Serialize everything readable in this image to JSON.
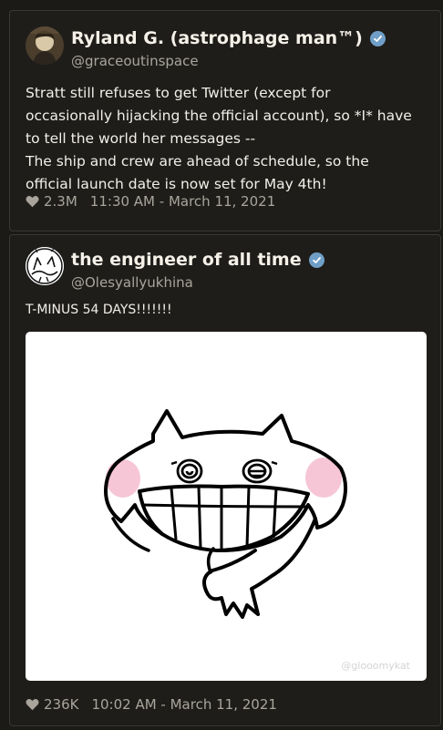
{
  "tweets": [
    {
      "display_name": "Ryland G. (astrophage man™)",
      "handle": "@graceoutinspace",
      "avatar_icon": "profile-photo",
      "verified_icon": "verified-check-icon",
      "text_lines": [
        "Stratt still refuses to get Twitter (except for",
        "occasionally hijacking the official account), so *I* have",
        "to tell the world her messages --",
        "The ship and crew are ahead of schedule, so the",
        "official launch date is now set for May 4th!"
      ],
      "likes": "2.3M",
      "timestamp": "11:30 AM - March 11, 2021"
    },
    {
      "display_name": "the engineer of all time",
      "handle": "@Olesyallyukhina",
      "avatar_icon": "cat-doodle-avatar",
      "verified_icon": "verified-check-icon",
      "text": "T-MINUS 54 DAYS!!!!!!!",
      "media_icon": "grinning-cat-doodle",
      "media_watermark": "@glooomykat",
      "likes": "236K",
      "timestamp": "10:02 AM - March 11, 2021"
    }
  ],
  "colors": {
    "background": "#1b1a17",
    "card": "#1e1d1a",
    "text": "#f2efe8",
    "muted": "#a9a59c",
    "verified": "#6f9fc7"
  }
}
